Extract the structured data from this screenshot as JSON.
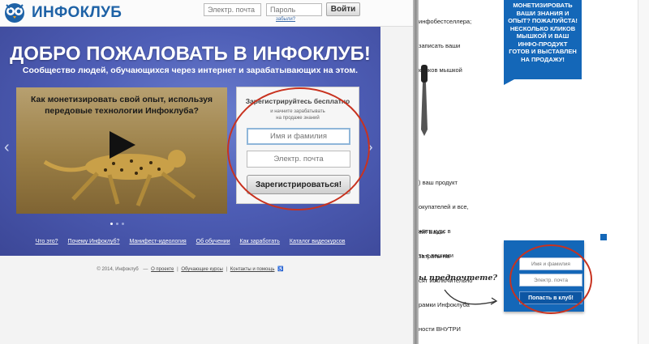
{
  "header": {
    "logo_text": "ИНФОКЛУБ",
    "email_placeholder": "Электр. почта",
    "password_placeholder": "Пароль",
    "forgot_link": "забыли?",
    "login_button": "Войти"
  },
  "hero": {
    "title": "ДОБРО ПОЖАЛОВАТЬ В ИНФОКЛУБ!",
    "subtitle": "Сообщество людей, обучающихся через интернет и зарабатывающих на этом.",
    "video_title_line1": "Как монетизировать свой опыт, используя",
    "video_title_line2": "передовые технологии Инфоклуба?",
    "arrow_left": "‹",
    "arrow_right": "›",
    "slides": 3,
    "active_slide": 1
  },
  "registration": {
    "title": "Зарегистрируйтесь бесплатно",
    "hint_line1": "и начните зарабатывать",
    "hint_line2": "на продаже знаний",
    "name_placeholder": "Имя и фамилия",
    "email_placeholder": "Электр. почта",
    "submit_label": "Зарегистрироваться!"
  },
  "nav": {
    "items": [
      "Что это?",
      "Почему Инфоклуб?",
      "Манифест-идеология",
      "Об обучении",
      "Как заработать",
      "Каталог видеокурсов"
    ]
  },
  "footer": {
    "copyright": "© 2014, Инфоклуб",
    "separator": "—",
    "about": "О проекте",
    "courses": "Обучающие курсы",
    "contacts": "Контакты и помощь"
  },
  "right_page": {
    "banner_lines": [
      "МОНЕТИЗИРОВАТЬ",
      "ВАШИ ЗНАНИЯ И",
      "ОПЫТ? ПОЖАЛУЙСТА!",
      "НЕСКОЛЬКО КЛИКОВ",
      "МЫШКОЙ И ВАШ",
      "ИНФО-ПРОДУКТ",
      "ГОТОВ И ВЫСТАВЛЕН",
      "НА ПРОДАЖУ!"
    ],
    "text_top": [
      "инфобестселлера;",
      "записать ваши",
      "кликов мышкой"
    ],
    "text_mid": [
      ") ваш продукт",
      "окупателей и все,",
      "жить курс в",
      "ть с вашими"
    ],
    "text_bottom": [
      "ей! Ваши",
      "затраты на",
      "сят исключительно",
      "рамки Инфоклуба",
      "ности ВНУТРИ"
    ],
    "handwritten": "ы предпочтете?",
    "club_name_placeholder": "Имя и фамилия",
    "club_email_placeholder": "Электр. почта",
    "club_button": "Попасть в клуб!"
  },
  "colors": {
    "brand_blue": "#1467b8",
    "hero_blue": "#4e5eb6",
    "annotation_red": "#c8321f"
  }
}
